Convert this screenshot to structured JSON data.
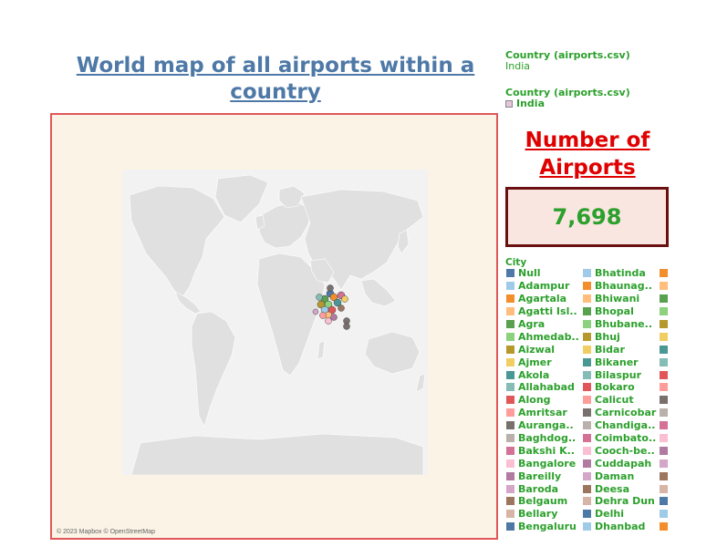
{
  "title": "World map of all airports within a country",
  "filters": [
    {
      "label": "Country (airports.csv)",
      "value": "India"
    },
    {
      "label": "Country (airports.csv)",
      "value": "India"
    }
  ],
  "map": {
    "credit": "© 2023 Mapbox © OpenStreetMap",
    "frame_color": "#e15759",
    "frame_bg": "#fbf3e6"
  },
  "kpi": {
    "title": "Number of Airports",
    "value": "7,698"
  },
  "city_legend": {
    "title": "City",
    "items": [
      {
        "label": "Null",
        "color": "#4e79a7"
      },
      {
        "label": "Adampur",
        "color": "#a0cbe8"
      },
      {
        "label": "Agartala",
        "color": "#f28e2b"
      },
      {
        "label": "Agatti Isl..",
        "color": "#ffbe7d"
      },
      {
        "label": "Agra",
        "color": "#59a14f"
      },
      {
        "label": "Ahmedab..",
        "color": "#8cd17d"
      },
      {
        "label": "Aizwal",
        "color": "#b6992d"
      },
      {
        "label": "Ajmer",
        "color": "#f1ce63"
      },
      {
        "label": "Akola",
        "color": "#499894"
      },
      {
        "label": "Allahabad",
        "color": "#86bcb6"
      },
      {
        "label": "Along",
        "color": "#e15759"
      },
      {
        "label": "Amritsar",
        "color": "#ff9d9a"
      },
      {
        "label": "Auranga..",
        "color": "#79706e"
      },
      {
        "label": "Baghdog..",
        "color": "#bab0ac"
      },
      {
        "label": "Bakshi K..",
        "color": "#d37295"
      },
      {
        "label": "Bangalore",
        "color": "#fabfd2"
      },
      {
        "label": "Bareilly",
        "color": "#b07aa1"
      },
      {
        "label": "Baroda",
        "color": "#d4a6c8"
      },
      {
        "label": "Belgaum",
        "color": "#9d7660"
      },
      {
        "label": "Bellary",
        "color": "#d7b5a6"
      },
      {
        "label": "Bengaluru",
        "color": "#4e79a7"
      },
      {
        "label": "Bhatinda",
        "color": "#a0cbe8"
      },
      {
        "label": "Bhaunag..",
        "color": "#f28e2b"
      },
      {
        "label": "Bhiwani",
        "color": "#ffbe7d"
      },
      {
        "label": "Bhopal",
        "color": "#59a14f"
      },
      {
        "label": "Bhubane..",
        "color": "#8cd17d"
      },
      {
        "label": "Bhuj",
        "color": "#b6992d"
      },
      {
        "label": "Bidar",
        "color": "#f1ce63"
      },
      {
        "label": "Bikaner",
        "color": "#499894"
      },
      {
        "label": "Bilaspur",
        "color": "#86bcb6"
      },
      {
        "label": "Bokaro",
        "color": "#e15759"
      },
      {
        "label": "Calicut",
        "color": "#ff9d9a"
      },
      {
        "label": "Carnicobar",
        "color": "#79706e"
      },
      {
        "label": "Chandiga..",
        "color": "#bab0ac"
      },
      {
        "label": "Coimbato..",
        "color": "#d37295"
      },
      {
        "label": "Cooch-be..",
        "color": "#fabfd2"
      },
      {
        "label": "Cuddapah",
        "color": "#b07aa1"
      },
      {
        "label": "Daman",
        "color": "#d4a6c8"
      },
      {
        "label": "Deesa",
        "color": "#9d7660"
      },
      {
        "label": "Dehra Dun",
        "color": "#d7b5a6"
      },
      {
        "label": "Delhi",
        "color": "#4e79a7"
      },
      {
        "label": "Dhanbad",
        "color": "#a0cbe8"
      },
      {
        "label": "",
        "color": "#f28e2b"
      },
      {
        "label": "",
        "color": "#ffbe7d"
      },
      {
        "label": "",
        "color": "#59a14f"
      },
      {
        "label": "",
        "color": "#8cd17d"
      },
      {
        "label": "",
        "color": "#b6992d"
      },
      {
        "label": "",
        "color": "#f1ce63"
      },
      {
        "label": "",
        "color": "#499894"
      },
      {
        "label": "",
        "color": "#86bcb6"
      },
      {
        "label": "",
        "color": "#e15759"
      },
      {
        "label": "",
        "color": "#ff9d9a"
      },
      {
        "label": "",
        "color": "#79706e"
      },
      {
        "label": "",
        "color": "#bab0ac"
      },
      {
        "label": "",
        "color": "#d37295"
      },
      {
        "label": "",
        "color": "#fabfd2"
      },
      {
        "label": "",
        "color": "#b07aa1"
      },
      {
        "label": "",
        "color": "#d4a6c8"
      },
      {
        "label": "",
        "color": "#9d7660"
      },
      {
        "label": "",
        "color": "#d7b5a6"
      },
      {
        "label": "",
        "color": "#4e79a7"
      },
      {
        "label": "",
        "color": "#a0cbe8"
      },
      {
        "label": "",
        "color": "#f28e2b"
      }
    ]
  }
}
